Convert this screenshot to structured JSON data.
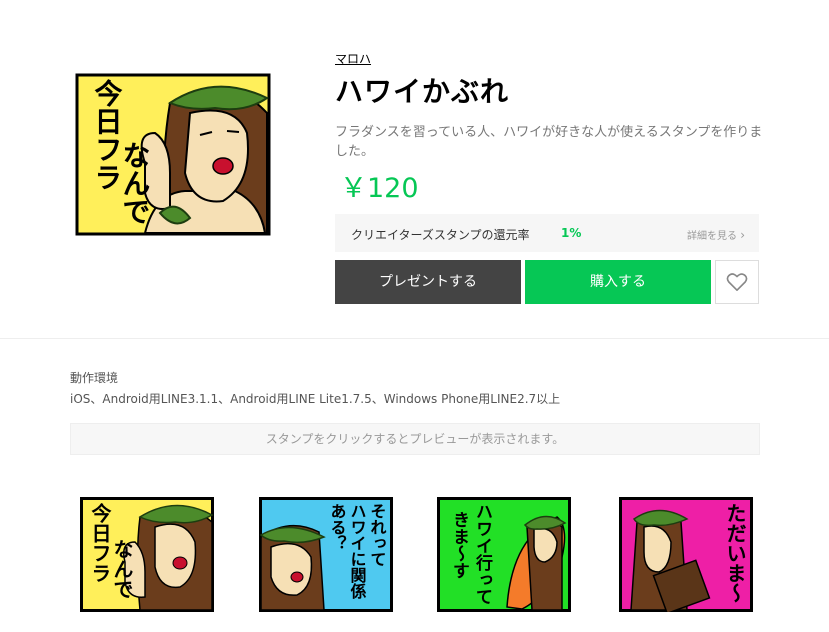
{
  "product": {
    "author": "マロハ",
    "title": "ハワイかぶれ",
    "description": "フラダンスを習っている人、ハワイが好きな人が使えるスタンプを作りました。",
    "price": "￥120",
    "main_sticker_text": "今日フラなんで"
  },
  "reward": {
    "label": "クリエイターズスタンプの還元率",
    "rate": "1%",
    "details_link": "詳細を見る"
  },
  "actions": {
    "present_label": "プレゼントする",
    "buy_label": "購入する",
    "favorite_icon": "heart-outline-icon"
  },
  "environment": {
    "title": "動作環境",
    "value": "iOS、Android用LINE3.1.1、Android用LINE Lite1.7.5、Windows Phone用LINE2.7以上"
  },
  "preview_hint": "スタンプをクリックするとプレビューが表示されます。",
  "stickers": [
    {
      "text": "今日フラなんで",
      "bg": "#ffef5a"
    },
    {
      "text": "それってハワイに関係ある？",
      "bg": "#4fc9f0"
    },
    {
      "text": "ハワイ行ってきま〜す",
      "bg": "#22e026"
    },
    {
      "text": "ただいま〜",
      "bg": "#ee1fa6"
    }
  ],
  "colors": {
    "accent": "#06c755",
    "present_button": "#444444"
  }
}
